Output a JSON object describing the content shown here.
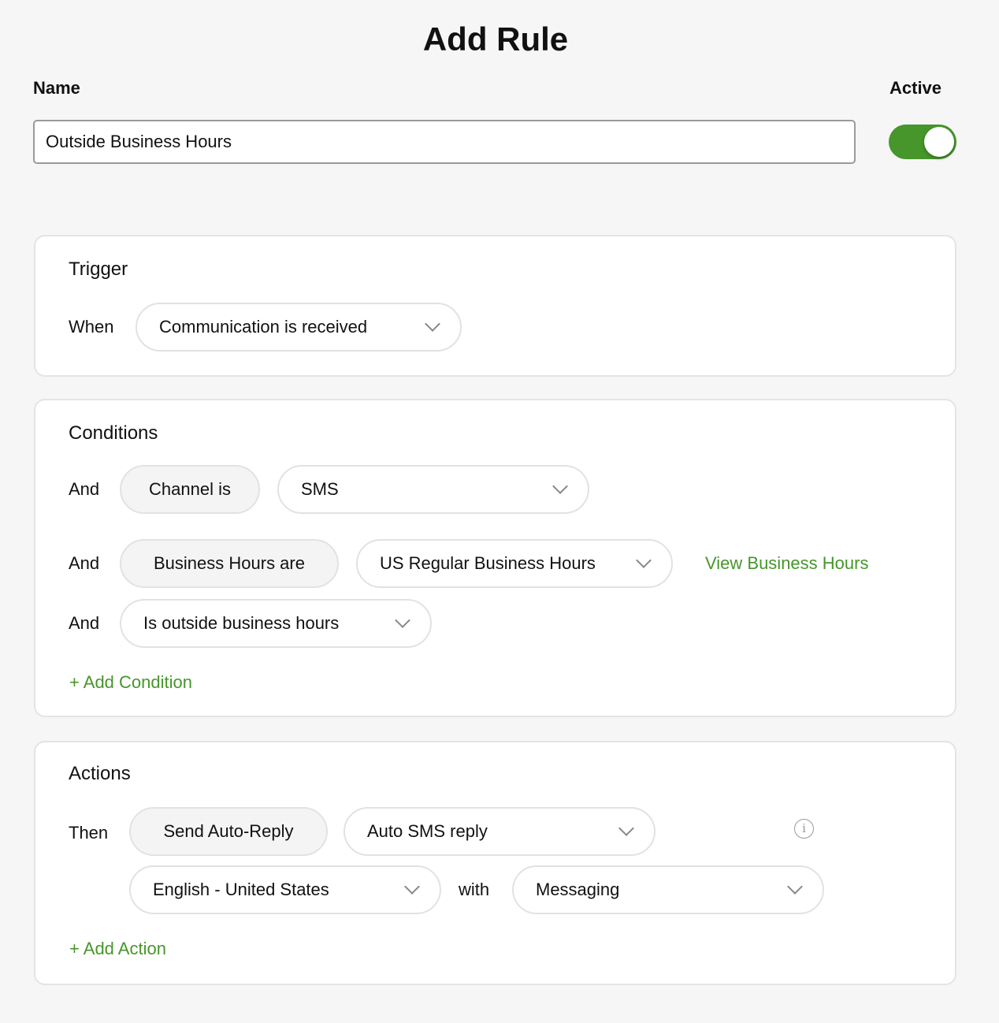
{
  "title": "Add Rule",
  "name": {
    "label": "Name",
    "value": "Outside Business Hours"
  },
  "active": {
    "label": "Active",
    "on": true,
    "color": "#46962b"
  },
  "trigger": {
    "heading": "Trigger",
    "when": "When",
    "select": "Communication is received"
  },
  "conditions": {
    "heading": "Conditions",
    "rows": [
      {
        "prefix": "And",
        "field": "Channel is",
        "value": "SMS"
      },
      {
        "prefix": "And",
        "field": "Business Hours are",
        "value": "US Regular Business Hours",
        "link": "View Business Hours"
      },
      {
        "prefix": "And",
        "value": "Is outside business hours"
      }
    ],
    "add": "Add Condition"
  },
  "actions": {
    "heading": "Actions",
    "then": "Then",
    "action": "Send Auto-Reply",
    "reply": "Auto SMS reply",
    "language": "English - United States",
    "with": "with",
    "channel": "Messaging",
    "add": "Add Action"
  },
  "icons": {
    "plus": "+",
    "info": "i"
  }
}
